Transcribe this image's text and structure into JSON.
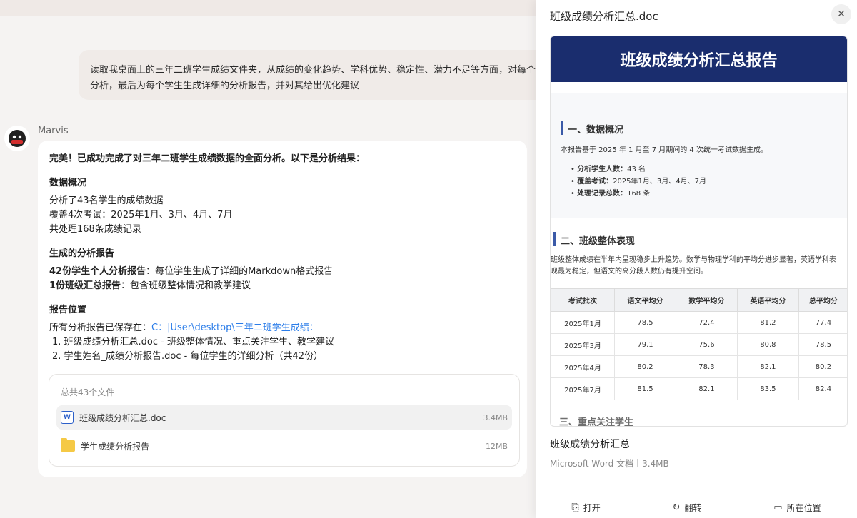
{
  "chat": {
    "user_message_line1": "读取我桌面上的三年二班学生成绩文件夹，从成绩的变化趋势、学科优势、稳定性、潜力不足等方面，对每个学生进",
    "user_message_line2": "分析，最后为每个学生生成详细的分析报告，并对其给出优化建议",
    "sender": "Marvis",
    "reply": {
      "intro": "完美！已成功完成了对三年二班学生成绩数据的全面分析。以下是分析结果：",
      "sec1_title": "数据概况",
      "sec1_lines": [
        "分析了43名学生的成绩数据",
        "覆盖4次考试：2025年1月、3月、4月、7月",
        "共处理168条成绩记录"
      ],
      "sec2_title": "生成的分析报告",
      "sec2_line1_bold": "42份学生个人分析报告",
      "sec2_line1_rest": "：每位学生生成了详细的Markdown格式报告",
      "sec2_line2_bold": "1份班级汇总报告",
      "sec2_line2_rest": "：包含班级整体情况和教学建议",
      "sec3_title": "报告位置",
      "sec3_line_prefix": "所有分析报告已保存在：",
      "sec3_path": "C：|User\\desktop\\三年二班学生成绩：",
      "sec3_item1": "1. 班级成绩分析汇总.doc - 班级整体情况、重点关注学生、教学建议",
      "sec3_item2": "2. 学生姓名_成绩分析报告.doc - 每位学生的详细分析（共42份）"
    },
    "files": {
      "header": "总共43个文件",
      "items": [
        {
          "name": "班级成绩分析汇总.doc",
          "size": "3.4MB",
          "icon": "word-doc-icon"
        },
        {
          "name": "学生成绩分析报告",
          "size": "12MB",
          "icon": "folder-icon"
        }
      ]
    }
  },
  "panel": {
    "title": "班级成绩分析汇总.doc",
    "close_glyph": "✕",
    "doc": {
      "banner": "班级成绩分析汇总报告",
      "s1_title": "一、数据概况",
      "s1_text": "本报告基于 2025 年 1 月至 7 月期间的 4 次统一考试数据生成。",
      "s1_items": [
        {
          "label": "分析学生人数：",
          "value": "43 名"
        },
        {
          "label": "覆盖考试：",
          "value": "2025年1月、3月、4月、7月"
        },
        {
          "label": "处理记录总数：",
          "value": "168 条"
        }
      ],
      "s2_title": "二、班级整体表现",
      "s2_text1": "班级整体成绩在半年内呈现稳步上升趋势。数学与物理学科的平均分进步显著，英语学科表",
      "s2_text2": "现最为稳定，但语文的高分段人数仍有提升空间。",
      "table_headers": [
        "考试批次",
        "语文平均分",
        "数学平均分",
        "英语平均分",
        "总平均分"
      ],
      "table_rows": [
        [
          "2025年1月",
          "78.5",
          "72.4",
          "81.2",
          "77.4"
        ],
        [
          "2025年3月",
          "79.1",
          "75.6",
          "80.8",
          "78.5"
        ],
        [
          "2025年4月",
          "80.2",
          "78.3",
          "82.1",
          "80.2"
        ],
        [
          "2025年7月",
          "81.5",
          "82.1",
          "83.5",
          "82.4"
        ]
      ],
      "s3_title": "三、重点关注学生"
    },
    "file_title": "班级成绩分析汇总",
    "file_meta": "Microsoft Word 文档丨3.4MB",
    "actions": {
      "open": "打开",
      "translate": "翻转",
      "location": "所在位置"
    }
  }
}
